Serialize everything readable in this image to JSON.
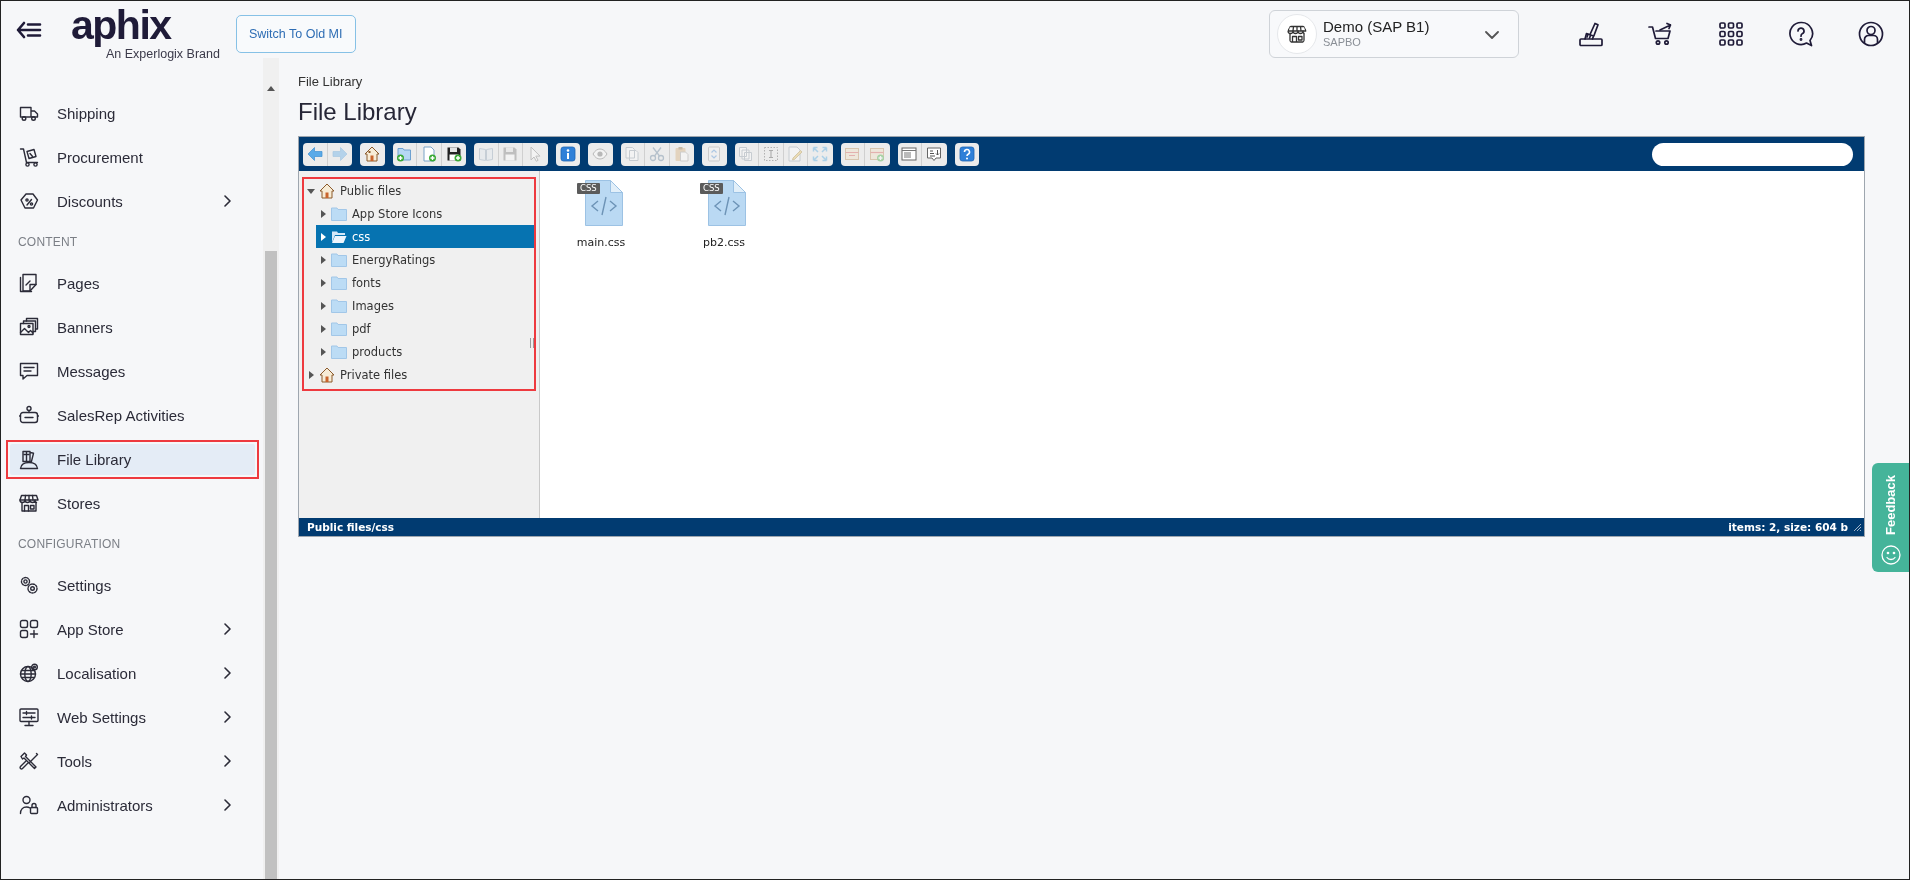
{
  "header": {
    "logo": {
      "wordmark": "aphix",
      "tagline": "An Experlogix Brand"
    },
    "switch_button": "Switch To Old MI",
    "store": {
      "name": "Demo (SAP B1)",
      "code": "SAPBO"
    }
  },
  "sidebar": {
    "sections": [
      {
        "items": [
          {
            "label": "Shipping",
            "submenu": false,
            "selected": false,
            "outlined": false
          },
          {
            "label": "Procurement",
            "submenu": false,
            "selected": false,
            "outlined": false
          },
          {
            "label": "Discounts",
            "submenu": true,
            "selected": false,
            "outlined": false
          }
        ]
      },
      {
        "heading": "CONTENT",
        "items": [
          {
            "label": "Pages",
            "submenu": false,
            "selected": false,
            "outlined": false
          },
          {
            "label": "Banners",
            "submenu": false,
            "selected": false,
            "outlined": false
          },
          {
            "label": "Messages",
            "submenu": false,
            "selected": false,
            "outlined": false
          },
          {
            "label": "SalesRep Activities",
            "submenu": false,
            "selected": false,
            "outlined": false
          },
          {
            "label": "File Library",
            "submenu": false,
            "selected": true,
            "outlined": true
          },
          {
            "label": "Stores",
            "submenu": false,
            "selected": false,
            "outlined": false
          }
        ]
      },
      {
        "heading": "CONFIGURATION",
        "items": [
          {
            "label": "Settings",
            "submenu": false,
            "selected": false,
            "outlined": false
          },
          {
            "label": "App Store",
            "submenu": true,
            "selected": false,
            "outlined": false
          },
          {
            "label": "Localisation",
            "submenu": true,
            "selected": false,
            "outlined": false
          },
          {
            "label": "Web Settings",
            "submenu": true,
            "selected": false,
            "outlined": false
          },
          {
            "label": "Tools",
            "submenu": true,
            "selected": false,
            "outlined": false
          },
          {
            "label": "Administrators",
            "submenu": true,
            "selected": false,
            "outlined": false
          }
        ]
      }
    ]
  },
  "breadcrumb": [
    "File Library"
  ],
  "page_title": "File Library",
  "file_manager": {
    "toolbar": [
      [
        {
          "kind": "back",
          "disabled": false
        },
        {
          "kind": "forward",
          "disabled": true
        }
      ],
      [
        {
          "kind": "home",
          "disabled": false
        }
      ],
      [
        {
          "kind": "mkdir",
          "disabled": false
        },
        {
          "kind": "mkfile",
          "disabled": false
        },
        {
          "kind": "upload",
          "disabled": false
        }
      ],
      [
        {
          "kind": "open",
          "disabled": true
        },
        {
          "kind": "download",
          "disabled": true
        },
        {
          "kind": "getfile",
          "disabled": true
        }
      ],
      [
        {
          "kind": "info",
          "disabled": false
        }
      ],
      [
        {
          "kind": "quicklook",
          "disabled": true
        }
      ],
      [
        {
          "kind": "copy",
          "disabled": true
        },
        {
          "kind": "cut",
          "disabled": true
        },
        {
          "kind": "paste",
          "disabled": true
        }
      ],
      [
        {
          "kind": "rm",
          "disabled": true
        }
      ],
      [
        {
          "kind": "duplicate",
          "disabled": true
        },
        {
          "kind": "rename",
          "disabled": true
        },
        {
          "kind": "edit",
          "disabled": true
        },
        {
          "kind": "resize",
          "disabled": true
        }
      ],
      [
        {
          "kind": "extract",
          "disabled": true
        },
        {
          "kind": "archive",
          "disabled": true
        }
      ],
      [
        {
          "kind": "view",
          "disabled": false
        },
        {
          "kind": "sort",
          "disabled": false
        }
      ],
      [
        {
          "kind": "help",
          "disabled": false
        }
      ]
    ],
    "tree": {
      "outlined": true,
      "items": [
        {
          "label": "Public files",
          "expanded": true,
          "selected": false,
          "children": [
            {
              "label": "App Store Icons",
              "expanded": false,
              "selected": false
            },
            {
              "label": "css",
              "expanded": false,
              "selected": true
            },
            {
              "label": "EnergyRatings",
              "expanded": false,
              "selected": false
            },
            {
              "label": "fonts",
              "expanded": false,
              "selected": false
            },
            {
              "label": "Images",
              "expanded": false,
              "selected": false
            },
            {
              "label": "pdf",
              "expanded": false,
              "selected": false
            },
            {
              "label": "products",
              "expanded": false,
              "selected": false
            }
          ]
        },
        {
          "label": "Private files",
          "expanded": false,
          "selected": false
        }
      ]
    },
    "files": [
      {
        "name": "main.css",
        "badge": "CSS"
      },
      {
        "name": "pb2.css",
        "badge": "CSS"
      }
    ],
    "status_bar": {
      "path": "Public files/css",
      "summary": "items: 2, size: 604 b"
    }
  },
  "feedback": {
    "label": "Feedback"
  }
}
